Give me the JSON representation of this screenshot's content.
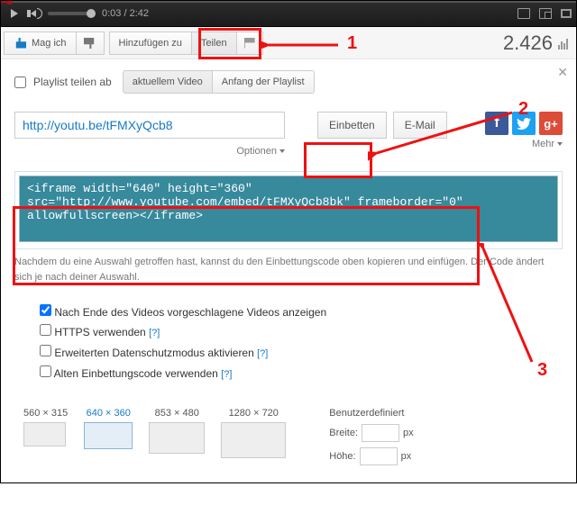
{
  "player": {
    "current_time": "0:03",
    "duration": "2:42"
  },
  "actions": {
    "like": "Mag ich",
    "add_to": "Hinzufügen zu",
    "share": "Teilen",
    "views": "2.426"
  },
  "panel": {
    "playlist_share_from": "Playlist teilen ab",
    "tab_current": "aktuellem Video",
    "tab_begin": "Anfang der Playlist",
    "share_url": "http://youtu.be/tFMXyQcb8",
    "embed_btn": "Einbetten",
    "email_btn": "E-Mail",
    "options": "Optionen",
    "more": "Mehr",
    "code": "<iframe width=\"640\" height=\"360\" src=\"http://www.youtube.com/embed/tFMXyQcb8bk\" frameborder=\"0\" allowfullscreen></iframe>",
    "hint": "Nachdem du eine Auswahl getroffen hast, kannst du den Einbettungscode oben kopieren und einfügen. Der Code ändert sich je nach deiner Auswahl."
  },
  "embed_opts": {
    "suggested": "Nach Ende des Videos vorgeschlagene Videos anzeigen",
    "https": "HTTPS verwenden",
    "privacy": "Erweiterten Datenschutzmodus aktivieren",
    "old": "Alten Einbettungscode verwenden",
    "help": "[?]"
  },
  "sizes": {
    "s1": "560 × 315",
    "s2": "640 × 360",
    "s3": "853 × 480",
    "s4": "1280 × 720",
    "custom_label": "Benutzerdefiniert",
    "width_label": "Breite:",
    "height_label": "Höhe:",
    "px": "px"
  },
  "annotations": {
    "n1": "1",
    "n2": "2",
    "n3": "3"
  },
  "social": {
    "fb": "f",
    "gp": "g+"
  }
}
